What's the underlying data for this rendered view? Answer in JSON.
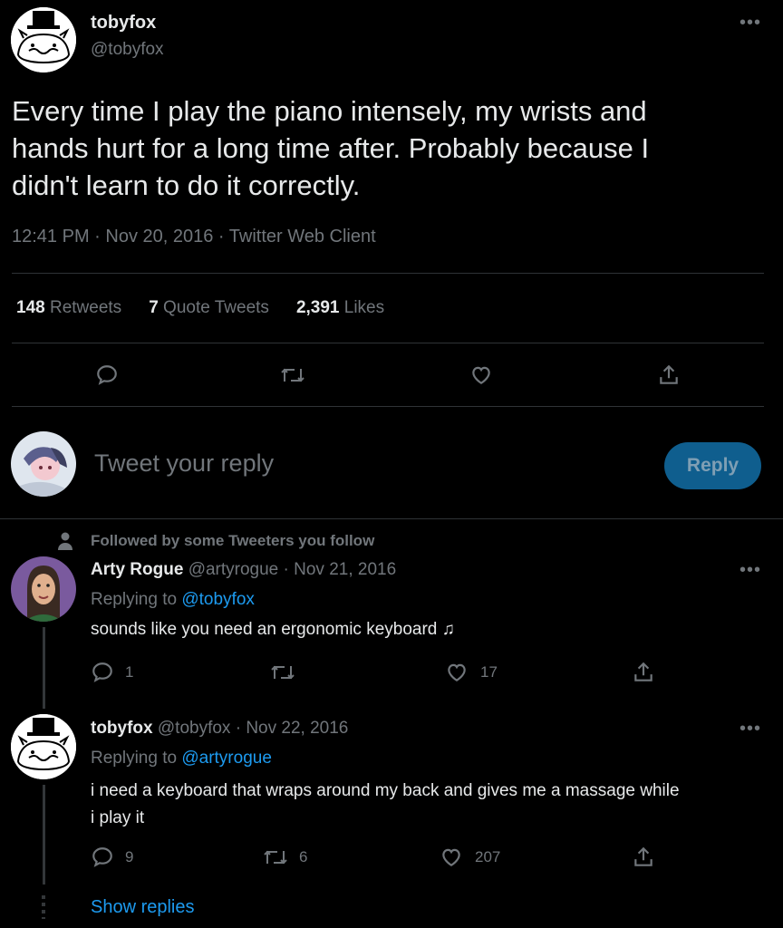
{
  "main_tweet": {
    "author_name": "tobyfox",
    "author_handle": "@tobyfox",
    "more_icon": "more-icon",
    "text_lines": [
      "Every time I play the piano intensely, my wrists and",
      "hands hurt for a long time after. Probably because I",
      "didn't learn to do it correctly."
    ],
    "meta": "12:41 PM · Nov 20, 2016 · Twitter Web Client",
    "stats": {
      "retweets_count": "148",
      "retweets_label": "Retweets",
      "quotes_count": "7",
      "quotes_label": "Quote Tweets",
      "likes_count": "2,391",
      "likes_label": "Likes"
    },
    "actions": [
      "reply-icon",
      "retweet-icon",
      "like-icon",
      "share-icon"
    ]
  },
  "composer": {
    "placeholder": "Tweet your reply",
    "reply_button": "Reply"
  },
  "replies": [
    {
      "social_context": "Followed by some Tweeters you follow",
      "author_name": "Arty Rogue",
      "author_handle": "@artyrogue",
      "date": "· Nov 21, 2016",
      "replying_prefix": "Replying to",
      "replying_to": "@tobyfox",
      "text": "sounds like you need an ergonomic keyboard ♫",
      "reply_count": "1",
      "retweet_count": "",
      "like_count": "17"
    },
    {
      "author_name": "tobyfox",
      "author_handle": "@tobyfox",
      "date": "· Nov 22, 2016",
      "replying_prefix": "Replying to",
      "replying_to": "@artyrogue",
      "text_lines": [
        "i need a keyboard that wraps around my back and gives me a massage while",
        "i play it"
      ],
      "reply_count": "9",
      "retweet_count": "6",
      "like_count": "207"
    }
  ],
  "show_replies": "Show replies",
  "colors": {
    "background": "#000000",
    "text": "#e7e9ea",
    "muted": "#71767b",
    "link": "#1d9bf0",
    "divider": "#2f3336",
    "reply_button_bg": "#0f5e8e"
  }
}
